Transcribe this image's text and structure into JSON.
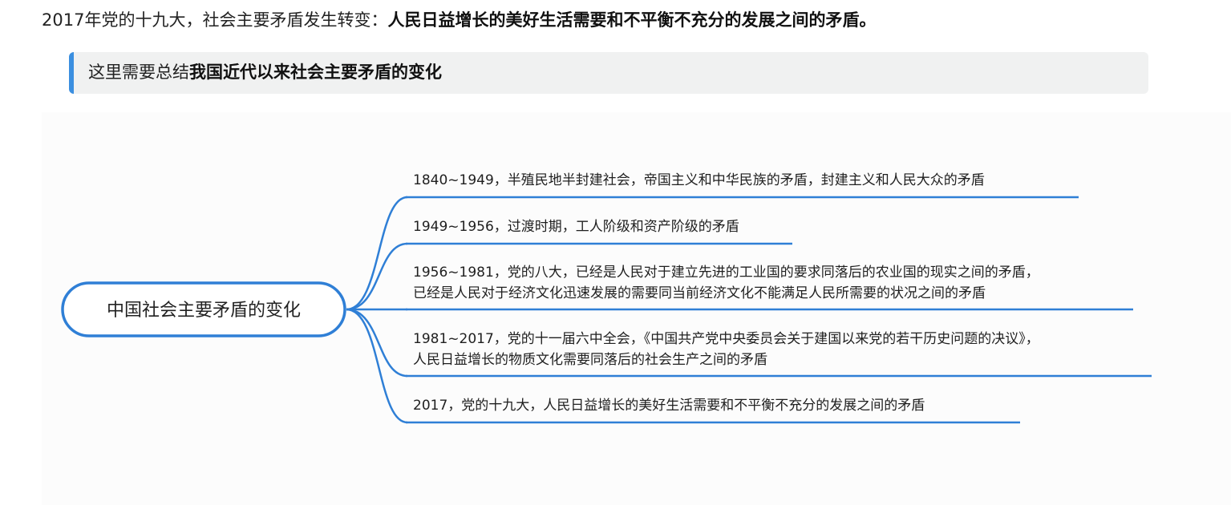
{
  "header": {
    "intro_text": "2017年党的十九大，社会主要矛盾发生转变：",
    "intro_bold": "人民日益增长的美好生活需要和不平衡不充分的发展之间的矛盾。"
  },
  "callout": {
    "text": "这里需要总结",
    "bold": "我国近代以来社会主要矛盾的变化",
    "accent_color": "#3b8fe0"
  },
  "mindmap": {
    "line_color": "#2f7fd6",
    "root": "中国社会主要矛盾的变化",
    "branches": [
      {
        "lines": [
          "1840~1949，半殖民地半封建社会，帝国主义和中华民族的矛盾，封建主义和人民大众的矛盾"
        ]
      },
      {
        "lines": [
          "1949~1956，过渡时期，工人阶级和资产阶级的矛盾"
        ]
      },
      {
        "lines": [
          "1956~1981，党的八大，已经是人民对于建立先进的工业国的要求同落后的农业国的现实之间的矛盾，",
          "已经是人民对于经济文化迅速发展的需要同当前经济文化不能满足人民所需要的状况之间的矛盾"
        ]
      },
      {
        "lines": [
          "1981~2017，党的十一届六中全会，《中国共产党中央委员会关于建国以来党的若干历史问题的决议》，",
          "人民日益增长的物质文化需要同落后的社会生产之间的矛盾"
        ]
      },
      {
        "lines": [
          "2017，党的十九大，人民日益增长的美好生活需要和不平衡不充分的发展之间的矛盾"
        ]
      }
    ]
  }
}
